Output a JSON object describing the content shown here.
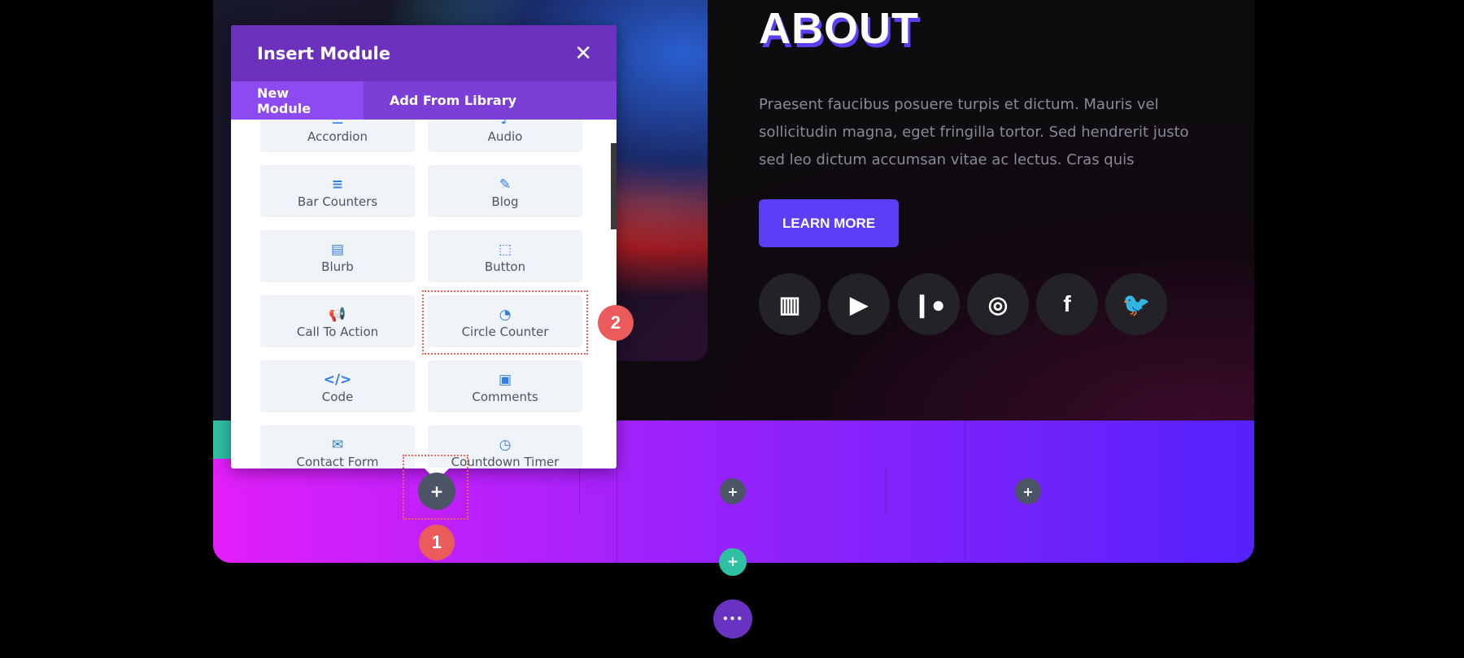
{
  "modal": {
    "title": "Insert Module",
    "tabs": [
      "New Module",
      "Add From Library"
    ],
    "modules": [
      {
        "label": "Accordion",
        "icon": "accordion-icon",
        "glyph": "☰"
      },
      {
        "label": "Audio",
        "icon": "audio-icon",
        "glyph": "♪"
      },
      {
        "label": "Bar Counters",
        "icon": "bar-counters-icon",
        "glyph": "≡"
      },
      {
        "label": "Blog",
        "icon": "blog-icon",
        "glyph": "✎"
      },
      {
        "label": "Blurb",
        "icon": "blurb-icon",
        "glyph": "▤"
      },
      {
        "label": "Button",
        "icon": "button-icon",
        "glyph": "⬚"
      },
      {
        "label": "Call To Action",
        "icon": "megaphone-icon",
        "glyph": "📢"
      },
      {
        "label": "Circle Counter",
        "icon": "circle-counter-icon",
        "glyph": "◔"
      },
      {
        "label": "Code",
        "icon": "code-icon",
        "glyph": "</>"
      },
      {
        "label": "Comments",
        "icon": "comments-icon",
        "glyph": "▣"
      },
      {
        "label": "Contact Form",
        "icon": "envelope-icon",
        "glyph": "✉"
      },
      {
        "label": "Countdown Timer",
        "icon": "clock-icon",
        "glyph": "◷"
      }
    ]
  },
  "about": {
    "heading": "ABOUT",
    "paragraph": "Praesent faucibus posuere turpis et dictum. Mauris vel sollicitudin magna, eget fringilla tortor. Sed hendrerit justo sed leo dictum accumsan vitae ac lectus. Cras quis",
    "button": "LEARN MORE"
  },
  "social": [
    {
      "name": "twitch-icon",
      "glyph": "▥"
    },
    {
      "name": "youtube-icon",
      "glyph": "▶"
    },
    {
      "name": "patreon-icon",
      "glyph": "❙●"
    },
    {
      "name": "instagram-icon",
      "glyph": "◎"
    },
    {
      "name": "facebook-icon",
      "glyph": "f"
    },
    {
      "name": "twitter-icon",
      "glyph": "🐦"
    }
  ],
  "annotations": {
    "step1": "1",
    "step2": "2"
  },
  "controls": {
    "plus": "+",
    "more": "•••",
    "close": "✕"
  },
  "colors": {
    "accent": "#5b3ff6",
    "modal_header": "#6c32bd",
    "tab_active": "#8d4af0",
    "badge": "#ec5b5b",
    "teal": "#2fc0a4"
  }
}
